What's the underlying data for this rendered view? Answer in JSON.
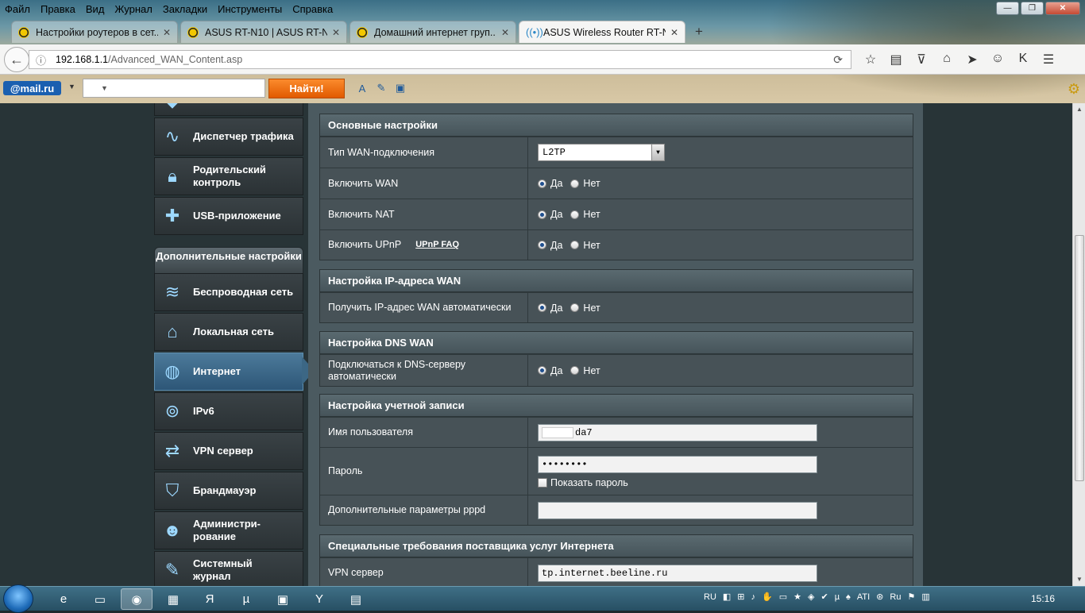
{
  "browser": {
    "menu": [
      "Файл",
      "Правка",
      "Вид",
      "Журнал",
      "Закладки",
      "Инструменты",
      "Справка"
    ],
    "tabs": [
      {
        "label": "Настройки роутеров в сет...",
        "active": false
      },
      {
        "label": "ASUS RT-N10 | ASUS RT-N...",
        "active": false
      },
      {
        "label": "Домашний интернет груп...",
        "active": false
      },
      {
        "label": "ASUS Wireless Router RT-N...",
        "active": true
      }
    ],
    "new_tab": "+",
    "url_host": "192.168.1.1",
    "url_path": "/Advanced_WAN_Content.asp"
  },
  "mailbar": {
    "logo": "@mail.ru",
    "find_button": "Найти!"
  },
  "sidebar": {
    "items_top": [
      {
        "label": "Диспетчер трафика",
        "icon": "traffic-icon"
      },
      {
        "label": "Родительский контроль",
        "icon": "lock-icon"
      },
      {
        "label": "USB-приложение",
        "icon": "puzzle-icon"
      }
    ],
    "advanced_header": "Дополнительные настройки",
    "items_adv": [
      {
        "label": "Беспроводная сеть",
        "icon": "wifi-icon"
      },
      {
        "label": "Локальная сеть",
        "icon": "home-icon"
      },
      {
        "label": "Интернет",
        "icon": "globe-icon",
        "active": true
      },
      {
        "label": "IPv6",
        "icon": "ipv6-icon"
      },
      {
        "label": "VPN сервер",
        "icon": "vpn-icon"
      },
      {
        "label": "Брандмауэр",
        "icon": "shield-icon"
      },
      {
        "label": "Администри-рование",
        "icon": "admin-icon"
      },
      {
        "label": "Системный журнал",
        "icon": "log-icon"
      }
    ]
  },
  "wan": {
    "basic": {
      "title": "Основные настройки",
      "wan_type_label": "Тип WAN-подключения",
      "wan_type_value": "L2TP",
      "enable_wan_label": "Включить WAN",
      "enable_nat_label": "Включить NAT",
      "enable_upnp_label": "Включить UPnP",
      "upnp_faq": "UPnP  FAQ"
    },
    "yes": "Да",
    "no": "Нет",
    "ip": {
      "title": "Настройка IP-адреса WAN",
      "auto_label": "Получить IP-адрес WAN автоматически"
    },
    "dns": {
      "title": "Настройка DNS WAN",
      "auto_label": "Подключаться к DNS-серверу автоматически"
    },
    "account": {
      "title": "Настройка учетной записи",
      "username_label": "Имя пользователя",
      "username_value": "da7",
      "password_label": "Пароль",
      "password_value": "••••••••",
      "show_password": "Показать пароль",
      "pppd_label": "Дополнительные параметры pppd"
    },
    "isp": {
      "title": "Специальные требования поставщика услуг Интернета",
      "vpn_label": "VPN сервер",
      "vpn_value": "tp.internet.beeline.ru"
    }
  },
  "taskbar": {
    "lang": "RU",
    "clock": "15:16"
  }
}
